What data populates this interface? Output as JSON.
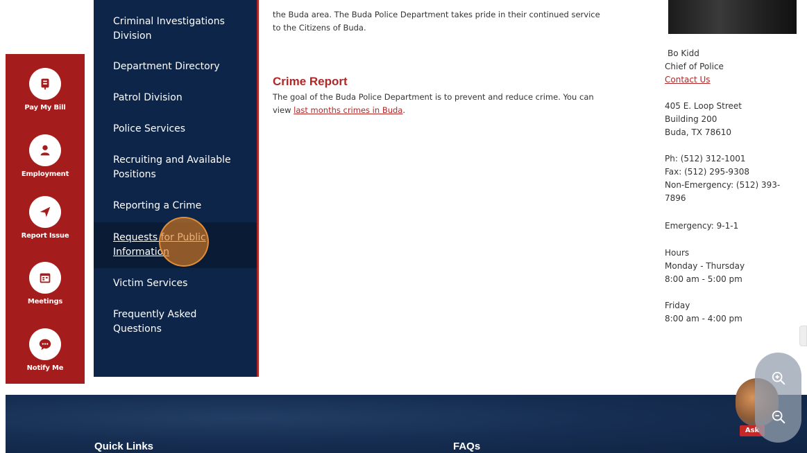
{
  "quick_actions": [
    {
      "label": "Pay My Bill",
      "icon": "bill-icon"
    },
    {
      "label": "Employment",
      "icon": "person-icon"
    },
    {
      "label": "Report Issue",
      "icon": "paper-plane-icon"
    },
    {
      "label": "Meetings",
      "icon": "calendar-icon"
    },
    {
      "label": "Notify Me",
      "icon": "chat-bubble-icon"
    }
  ],
  "sidenav": {
    "items": [
      {
        "label": "Criminal Investigations Division"
      },
      {
        "label": "Department Directory"
      },
      {
        "label": "Patrol Division"
      },
      {
        "label": "Police Services"
      },
      {
        "label": "Recruiting and Available Positions"
      },
      {
        "label": "Reporting a Crime"
      },
      {
        "label": "Requests for Public Information"
      },
      {
        "label": "Victim Services"
      },
      {
        "label": "Frequently Asked Questions"
      }
    ],
    "active_index": 6
  },
  "main": {
    "intro_line1": "the Buda area. The Buda Police Department takes pride in their continued service",
    "intro_line2": "to the Citizens of Buda.",
    "crime_report_title": "Crime Report",
    "crime_report_text1": "The goal of the Buda Police Department is to prevent and reduce crime. You can",
    "crime_report_text2_prefix": "view",
    "crime_report_link": "last months crimes in Buda",
    "crime_report_text2_suffix": "."
  },
  "contact": {
    "name": "Bo Kidd",
    "title": "Chief of Police",
    "contact_link": "Contact Us",
    "address1": "405 E. Loop Street",
    "address2": "Building 200",
    "address3": "Buda, TX 78610",
    "phone": "Ph: (512) 312-1001",
    "fax": "Fax: (512) 295-9308",
    "non_emergency1": "Non-Emergency: (512) 393-",
    "non_emergency2": "7896",
    "emergency": "Emergency: 9-1-1",
    "hours_label": "Hours",
    "weekday_days": "Monday - Thursday",
    "weekday_hours": "8:00 am - 5:00 pm",
    "friday_days": "Friday",
    "friday_hours": "8:00 am - 4:00 pm"
  },
  "footer": {
    "quick_links": "Quick Links",
    "faqs": "FAQs"
  },
  "chatbot": {
    "label": "Ask"
  },
  "colors": {
    "rail_red": "#a51c1c",
    "nav_navy": "#0d2549",
    "accent_red": "#b32626",
    "footer_navy": "#162e52"
  }
}
